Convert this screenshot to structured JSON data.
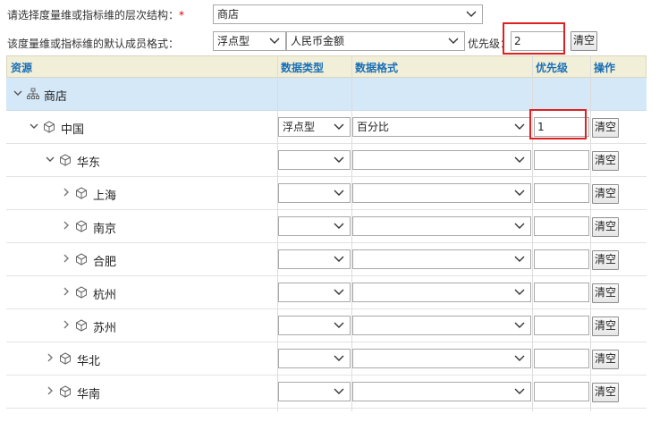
{
  "form": {
    "hierarchy_label": "请选择度量维或指标维的层次结构：",
    "hierarchy_required": "*",
    "hierarchy_value": "商店",
    "format_label": "该度量维或指标维的默认成员格式：",
    "default_type": "浮点型",
    "default_format": "人民币金额",
    "priority_label": "优先级：",
    "priority_value": "2",
    "clear_label": "清空"
  },
  "table": {
    "headers": {
      "resource": "资源",
      "data_type": "数据类型",
      "data_format": "数据格式",
      "priority": "优先级",
      "action": "操作"
    },
    "root": {
      "name": "商店"
    },
    "rows": [
      {
        "name": "中国",
        "type": "浮点型",
        "format": "百分比",
        "priority": "1",
        "clear": "清空",
        "expanded": true
      },
      {
        "name": "华东",
        "type": "",
        "format": "",
        "priority": "",
        "clear": "清空",
        "expanded": true
      },
      {
        "name": "上海",
        "type": "",
        "format": "",
        "priority": "",
        "clear": "清空",
        "expanded": false
      },
      {
        "name": "南京",
        "type": "",
        "format": "",
        "priority": "",
        "clear": "清空",
        "expanded": false
      },
      {
        "name": "合肥",
        "type": "",
        "format": "",
        "priority": "",
        "clear": "清空",
        "expanded": false
      },
      {
        "name": "杭州",
        "type": "",
        "format": "",
        "priority": "",
        "clear": "清空",
        "expanded": false
      },
      {
        "name": "苏州",
        "type": "",
        "format": "",
        "priority": "",
        "clear": "清空",
        "expanded": false
      },
      {
        "name": "华北",
        "type": "",
        "format": "",
        "priority": "",
        "clear": "清空",
        "expanded": false
      },
      {
        "name": "华南",
        "type": "",
        "format": "",
        "priority": "",
        "clear": "清空",
        "expanded": false
      }
    ]
  },
  "icons": {
    "root": "hierarchy-icon",
    "member": "cube-icon",
    "expand": "chevron-down-icon",
    "collapse": "chevron-right-icon",
    "dropdown": "dropdown-arrow-icon"
  },
  "colors": {
    "header_bg": "#f2efd9",
    "header_text": "#1a6fb5",
    "root_row_bg": "#d4e8f8",
    "highlight_border": "#e02020"
  }
}
